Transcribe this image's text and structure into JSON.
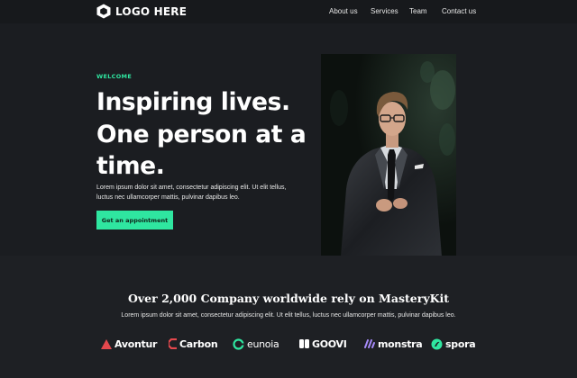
{
  "nav": {
    "logo_text": "LOGO HERE",
    "links": [
      {
        "label": "About us"
      },
      {
        "label": "Services"
      },
      {
        "label": "Team"
      },
      {
        "label": "Contact us"
      }
    ]
  },
  "hero": {
    "eyebrow": "WELCOME",
    "headline": "Inspiring lives. One person at a time.",
    "subtext": "Lorem ipsum dolor sit amet, consectetur adipiscing elit. Ut elit tellus, luctus nec ullamcorper mattis, pulvinar dapibus leo.",
    "cta_label": "Get an appointment"
  },
  "trust": {
    "title": "Over 2,000 Company worldwide rely on MasteryKit",
    "subtext": "Lorem ipsum dolor sit amet, consectetur adipiscing elit. Ut elit tellus, luctus nec ullamcorper mattis, pulvinar dapibus leo.",
    "brands": [
      {
        "name": "Avontur",
        "icon": "avontur-logo-icon",
        "color": "#e5484d"
      },
      {
        "name": "Carbon",
        "icon": "carbon-logo-icon",
        "color": "#e5484d"
      },
      {
        "name": "eunoia",
        "icon": "eunoia-logo-icon",
        "color": "#2fe6a0"
      },
      {
        "name": "GOOVI",
        "icon": "goovi-logo-icon",
        "color": "#ffffff"
      },
      {
        "name": "monstra",
        "icon": "monstra-logo-icon",
        "color": "#a78bfa"
      },
      {
        "name": "spora",
        "icon": "spora-logo-icon",
        "color": "#2fe6a0"
      }
    ]
  },
  "colors": {
    "accent": "#2fe6a0",
    "background": "#1b1d21",
    "nav_background": "#17191c"
  }
}
